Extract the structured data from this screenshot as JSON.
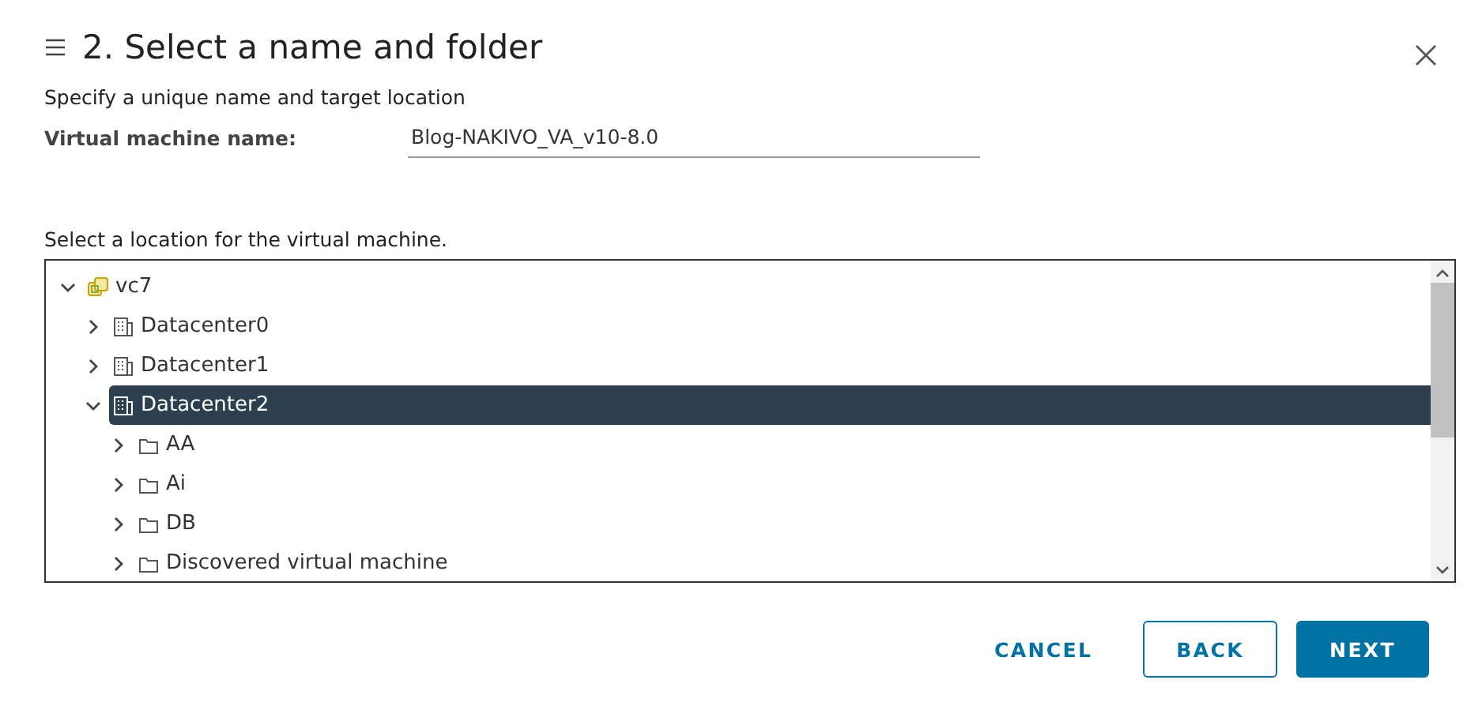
{
  "dialog": {
    "title": "2. Select a name and folder",
    "subtitle": "Specify a unique name and target location"
  },
  "name_field": {
    "label": "Virtual machine name:",
    "value": "Blog-NAKIVO_VA_v10-8.0"
  },
  "location": {
    "label": "Select a location for the virtual machine.",
    "tree": [
      {
        "label": "vc7",
        "kind": "vcenter",
        "expanded": true,
        "selected": false,
        "children": [
          {
            "label": "Datacenter0",
            "kind": "datacenter",
            "expanded": false,
            "selected": false
          },
          {
            "label": "Datacenter1",
            "kind": "datacenter",
            "expanded": false,
            "selected": false
          },
          {
            "label": "Datacenter2",
            "kind": "datacenter",
            "expanded": true,
            "selected": true,
            "children": [
              {
                "label": "AA",
                "kind": "folder",
                "expanded": false,
                "selected": false
              },
              {
                "label": "Ai",
                "kind": "folder",
                "expanded": false,
                "selected": false
              },
              {
                "label": "DB",
                "kind": "folder",
                "expanded": false,
                "selected": false
              },
              {
                "label": "Discovered virtual machine",
                "kind": "folder",
                "expanded": false,
                "selected": false
              }
            ]
          }
        ]
      }
    ]
  },
  "buttons": [
    {
      "label": "CANCEL",
      "kind": "flat"
    },
    {
      "label": "BACK",
      "kind": "outline"
    },
    {
      "label": "NEXT",
      "kind": "primary"
    }
  ]
}
